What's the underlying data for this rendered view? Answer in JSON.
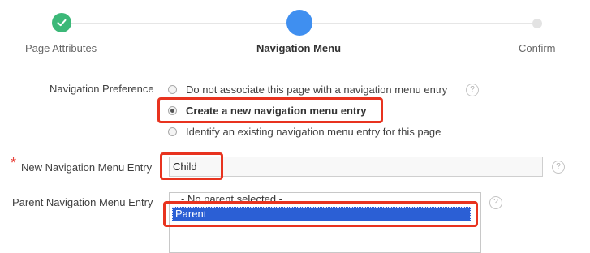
{
  "wizard": {
    "steps": [
      {
        "label": "Page Attributes",
        "state": "done"
      },
      {
        "label": "Navigation Menu",
        "state": "current"
      },
      {
        "label": "Confirm",
        "state": "future"
      }
    ],
    "check_glyph": "✓"
  },
  "form": {
    "navigation_preference": {
      "label": "Navigation Preference",
      "options": [
        {
          "label": "Do not associate this page with a navigation menu entry",
          "checked": false
        },
        {
          "label": "Create a new navigation menu entry",
          "checked": true
        },
        {
          "label": "Identify an existing navigation menu entry for this page",
          "checked": false
        }
      ]
    },
    "new_entry": {
      "label": "New Navigation Menu Entry",
      "required_mark": "*",
      "value": "Child"
    },
    "parent_entry": {
      "label": "Parent Navigation Menu Entry",
      "options": [
        {
          "label": "- No parent selected -",
          "selected": false
        },
        {
          "label": "Parent",
          "selected": true
        }
      ]
    },
    "help_glyph": "?"
  },
  "colors": {
    "done_step": "#3cb878",
    "current_step": "#3f8ff0",
    "highlight": "#e8331f",
    "list_selection": "#2b5fd5"
  },
  "icons": [
    "check-icon",
    "help-icon"
  ]
}
